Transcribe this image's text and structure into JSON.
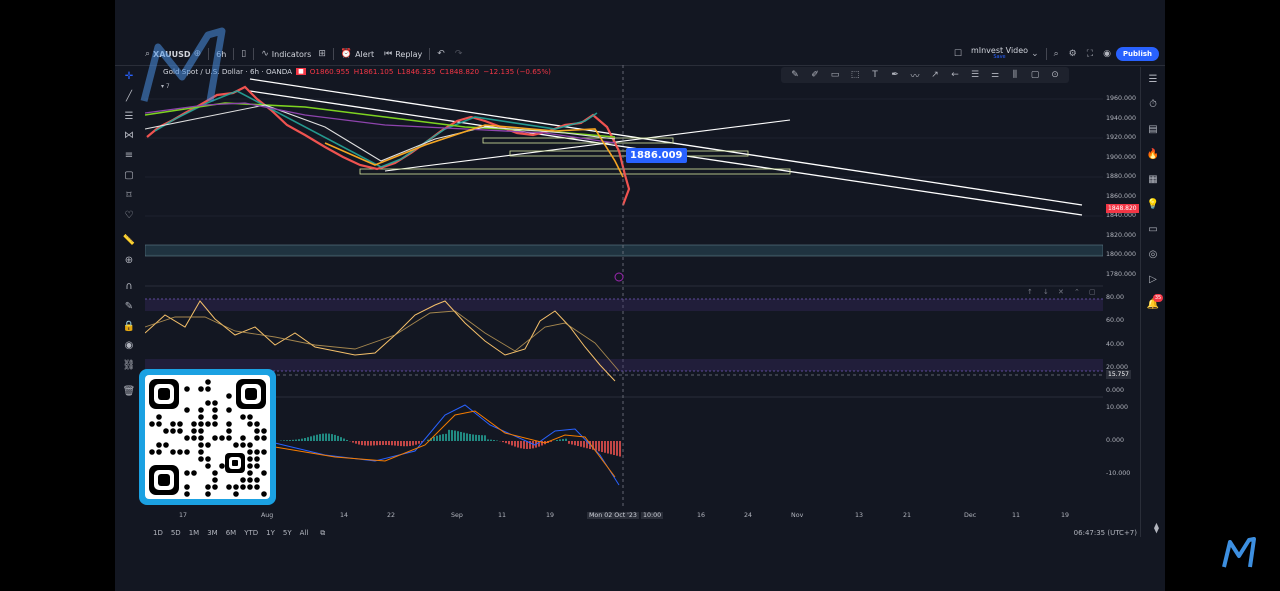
{
  "toolbar": {
    "symbol": "XAUUSD",
    "interval": "6h",
    "indicators_label": "Indicators",
    "alert_label": "Alert",
    "replay_label": "Replay",
    "layout_name": "mInvest Video",
    "layout_sub": "Save",
    "publish_label": "Publish"
  },
  "legend": {
    "title": "Gold Spot / U.S. Dollar · 6h · OANDA",
    "open": "O1860.955",
    "high": "H1861.105",
    "low": "L1846.335",
    "close": "C1848.820",
    "change": "−12.135 (−0.65%)",
    "indicator_count": "7"
  },
  "price_callout": "1886.009",
  "price_scale": [
    "1960.000",
    "1940.000",
    "1920.000",
    "1900.000",
    "1880.000",
    "1860.000",
    "1840.000",
    "1820.000",
    "1800.000",
    "1780.000"
  ],
  "current_price": "1848.820",
  "rsi_scale": [
    "80.00",
    "60.00",
    "40.00",
    "20.000",
    "0.000"
  ],
  "rsi_value": "15.757",
  "macd_scale": [
    "10.000",
    "0.000",
    "-10.000"
  ],
  "time_axis": [
    "17",
    "Aug",
    "14",
    "22",
    "Sep",
    "11",
    "19",
    "Mon 02 Oct '23",
    "10:00",
    "16",
    "24",
    "Nov",
    "13",
    "21",
    "Dec",
    "11",
    "19"
  ],
  "ranges": [
    "1D",
    "5D",
    "1M",
    "3M",
    "6M",
    "YTD",
    "1Y",
    "5Y",
    "All"
  ],
  "clock": "06:47:35 (UTC+7)",
  "alerts_badge": "35",
  "colors": {
    "bg": "#131722",
    "accent": "#2962ff",
    "down": "#f23645",
    "qr_frame": "#1ba1e2"
  }
}
